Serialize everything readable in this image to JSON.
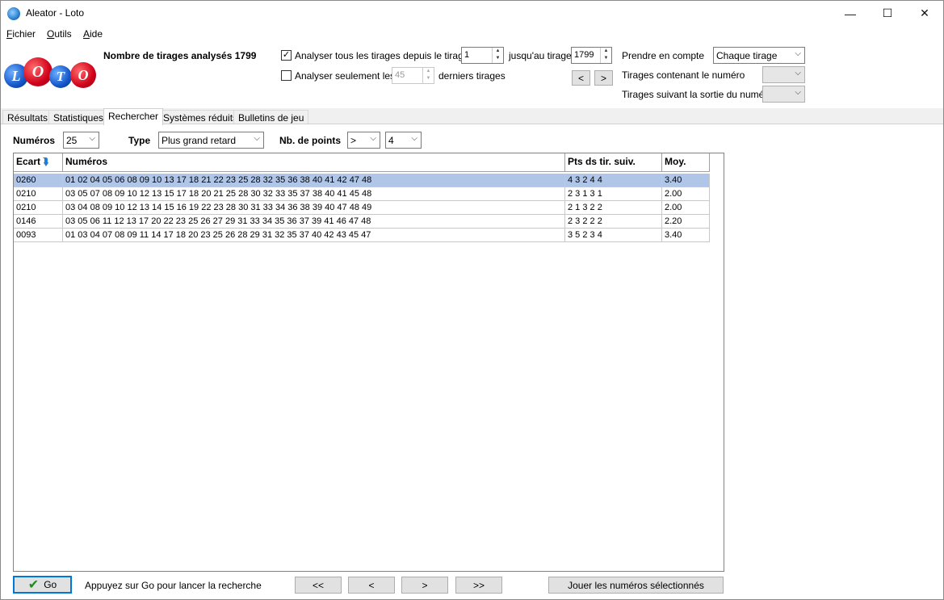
{
  "window": {
    "title": "Aleator - Loto",
    "minimize": "—",
    "maximize": "☐",
    "close": "✕"
  },
  "menu": {
    "fichier_first": "F",
    "fichier_rest": "ichier",
    "outils_first": "O",
    "outils_rest": "utils",
    "aide_first": "A",
    "aide_rest": "ide"
  },
  "logo": {
    "letters": [
      "L",
      "O",
      "T",
      "O"
    ]
  },
  "header": {
    "analyzed": "Nombre de tirages analysés 1799",
    "analyze_all_label": "Analyser tous les tirages depuis le tirage",
    "analyze_all_checked": "✓",
    "from_value": "1",
    "until_label": "jusqu'au tirage",
    "until_value": "1799",
    "analyze_only_label": "Analyser seulement les",
    "only_value": "45",
    "last_draws_label": "derniers tirages",
    "prev_btn": "<",
    "next_btn": ">",
    "consider_label": "Prendre en compte",
    "consider_value": "Chaque tirage",
    "containing_label": "Tirages contenant le numéro",
    "following_label": "Tirages suivant la sortie du numéro"
  },
  "tabs": [
    "Résultats",
    "Statistiques",
    "Rechercher",
    "Systèmes réduits",
    "Bulletins de jeu"
  ],
  "filters": {
    "numeros_label": "Numéros",
    "numeros_value": "25",
    "type_label": "Type",
    "type_value": "Plus grand retard",
    "points_label": "Nb. de points",
    "op_value": ">",
    "points_value": "4"
  },
  "grid": {
    "headers": [
      "Ecart",
      "Numéros",
      "Pts ds tir. suiv.",
      "Moy."
    ],
    "rows": [
      {
        "ecart": "0260",
        "numeros": "01 02 04 05 06 08 09 10 13 17 18 21 22 23 25 28 32 35 36 38 40 41 42 47 48",
        "pts": "4 3 2 4 4",
        "moy": "3.40"
      },
      {
        "ecart": "0210",
        "numeros": "03 05 07 08 09 10 12 13 15 17 18 20 21 25 28 30 32 33 35 37 38 40 41 45 48",
        "pts": "2 3 1 3 1",
        "moy": "2.00"
      },
      {
        "ecart": "0210",
        "numeros": "03 04 08 09 10 12 13 14 15 16 19 22 23 28 30 31 33 34 36 38 39 40 47 48 49",
        "pts": "2 1 3 2 2",
        "moy": "2.00"
      },
      {
        "ecart": "0146",
        "numeros": "03 05 06 11 12 13 17 20 22 23 25 26 27 29 31 33 34 35 36 37 39 41 46 47 48",
        "pts": "2 3 2 2 2",
        "moy": "2.20"
      },
      {
        "ecart": "0093",
        "numeros": "01 03 04 07 08 09 11 14 17 18 20 23 25 26 28 29 31 32 35 37 40 42 43 45 47",
        "pts": "3 5 2 3 4",
        "moy": "3.40"
      }
    ]
  },
  "footer": {
    "go_label": "Go",
    "hint": "Appuyez sur Go pour lancer la recherche",
    "first": "<<",
    "prev": "<",
    "next": ">",
    "last": ">>",
    "play": "Jouer les numéros sélectionnés"
  }
}
